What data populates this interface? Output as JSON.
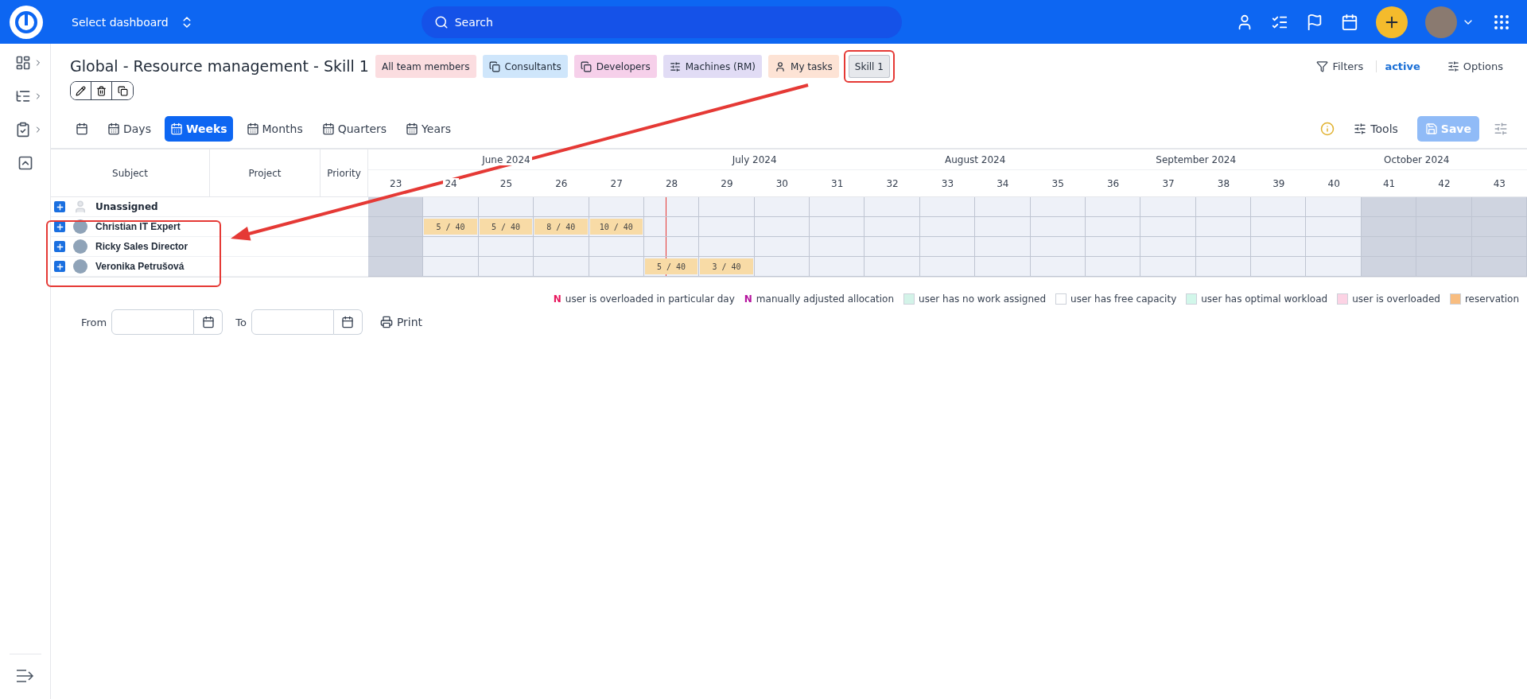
{
  "topbar": {
    "dashboard_select": "Select dashboard",
    "search": {
      "placeholder": "Search"
    }
  },
  "header": {
    "title": "Global - Resource management - Skill 1",
    "chips": [
      {
        "label": "All team members",
        "color": "#fbdde0",
        "kind": "plain",
        "selected": false
      },
      {
        "label": "Consultants",
        "color": "#cfe6fb",
        "kind": "team",
        "selected": false
      },
      {
        "label": "Developers",
        "color": "#f6d0ea",
        "kind": "team",
        "selected": false
      },
      {
        "label": "Machines (RM)",
        "color": "#e1dcf5",
        "kind": "machine",
        "selected": false
      },
      {
        "label": "My tasks",
        "color": "#fde3d5",
        "kind": "personal",
        "selected": false
      },
      {
        "label": "Skill 1",
        "color": "#e6e8ec",
        "kind": "plain",
        "selected": true
      }
    ],
    "filters": {
      "label": "Filters",
      "state": "active"
    },
    "options": "Options"
  },
  "views": [
    {
      "kind": "icon",
      "selected": false
    },
    {
      "kind": "text",
      "label": "Days",
      "selected": false
    },
    {
      "kind": "text",
      "label": "Weeks",
      "selected": true
    },
    {
      "kind": "text",
      "label": "Months",
      "selected": false
    },
    {
      "kind": "text",
      "label": "Quarters",
      "selected": false
    },
    {
      "kind": "text",
      "label": "Years",
      "selected": false
    }
  ],
  "toolbar": {
    "tools": "Tools",
    "save": {
      "label": "Save",
      "disabled": true
    }
  },
  "table": {
    "columns": [
      "Subject",
      "Project",
      "Priority"
    ],
    "months": [
      {
        "label": "June 2024",
        "weeks": [
          {
            "label": "23",
            "shaded": true
          },
          {
            "label": "24",
            "shaded": false
          },
          {
            "label": "25",
            "shaded": false
          },
          {
            "label": "26",
            "shaded": false
          },
          {
            "label": "27",
            "shaded": false
          }
        ]
      },
      {
        "label": "July 2024",
        "weeks": [
          {
            "label": "28",
            "shaded": false,
            "today": true
          },
          {
            "label": "29",
            "shaded": false
          },
          {
            "label": "30",
            "shaded": false
          },
          {
            "label": "31",
            "shaded": false
          }
        ]
      },
      {
        "label": "August 2024",
        "weeks": [
          {
            "label": "32",
            "shaded": false
          },
          {
            "label": "33",
            "shaded": false
          },
          {
            "label": "34",
            "shaded": false
          },
          {
            "label": "35",
            "shaded": false
          }
        ]
      },
      {
        "label": "September 2024",
        "weeks": [
          {
            "label": "36",
            "shaded": false
          },
          {
            "label": "37",
            "shaded": false
          },
          {
            "label": "38",
            "shaded": false
          },
          {
            "label": "39",
            "shaded": false
          }
        ]
      },
      {
        "label": "October 2024",
        "weeks": [
          {
            "label": "40",
            "shaded": false
          },
          {
            "label": "41",
            "shaded": true
          },
          {
            "label": "42",
            "shaded": true
          },
          {
            "label": "43",
            "shaded": true
          }
        ]
      }
    ],
    "rows": [
      {
        "name": "Unassigned",
        "kind": "unassigned",
        "cells": [
          {
            "kind": "empty"
          },
          {
            "kind": "empty"
          },
          {
            "kind": "empty"
          },
          {
            "kind": "empty"
          },
          {
            "kind": "empty"
          },
          {
            "kind": "empty"
          },
          {
            "kind": "empty"
          },
          {
            "kind": "empty"
          },
          {
            "kind": "empty"
          },
          {
            "kind": "empty"
          },
          {
            "kind": "empty"
          },
          {
            "kind": "empty"
          },
          {
            "kind": "empty"
          },
          {
            "kind": "empty"
          },
          {
            "kind": "empty"
          },
          {
            "kind": "empty"
          },
          {
            "kind": "empty"
          },
          {
            "kind": "empty"
          },
          {
            "kind": "empty"
          },
          {
            "kind": "empty"
          },
          {
            "kind": "empty"
          }
        ]
      },
      {
        "name": "Christian IT Expert",
        "kind": "user",
        "cells": [
          {
            "kind": "empty"
          },
          {
            "kind": "reservation",
            "text": "5 / 40"
          },
          {
            "kind": "reservation",
            "text": "5 / 40"
          },
          {
            "kind": "reservation",
            "text": "8 / 40"
          },
          {
            "kind": "reservation",
            "text": "10 / 40"
          },
          {
            "kind": "empty"
          },
          {
            "kind": "empty"
          },
          {
            "kind": "empty"
          },
          {
            "kind": "empty"
          },
          {
            "kind": "empty"
          },
          {
            "kind": "empty"
          },
          {
            "kind": "empty"
          },
          {
            "kind": "empty"
          },
          {
            "kind": "empty"
          },
          {
            "kind": "empty"
          },
          {
            "kind": "empty"
          },
          {
            "kind": "empty"
          },
          {
            "kind": "empty"
          },
          {
            "kind": "empty"
          },
          {
            "kind": "empty"
          },
          {
            "kind": "empty"
          }
        ]
      },
      {
        "name": "Ricky Sales Director",
        "kind": "user",
        "cells": [
          {
            "kind": "empty"
          },
          {
            "kind": "empty"
          },
          {
            "kind": "empty"
          },
          {
            "kind": "empty"
          },
          {
            "kind": "empty"
          },
          {
            "kind": "empty"
          },
          {
            "kind": "empty"
          },
          {
            "kind": "empty"
          },
          {
            "kind": "empty"
          },
          {
            "kind": "empty"
          },
          {
            "kind": "empty"
          },
          {
            "kind": "empty"
          },
          {
            "kind": "empty"
          },
          {
            "kind": "empty"
          },
          {
            "kind": "empty"
          },
          {
            "kind": "empty"
          },
          {
            "kind": "empty"
          },
          {
            "kind": "empty"
          },
          {
            "kind": "empty"
          },
          {
            "kind": "empty"
          },
          {
            "kind": "empty"
          }
        ]
      },
      {
        "name": "Veronika Petrušová",
        "kind": "user",
        "cells": [
          {
            "kind": "empty"
          },
          {
            "kind": "empty"
          },
          {
            "kind": "empty"
          },
          {
            "kind": "empty"
          },
          {
            "kind": "empty"
          },
          {
            "kind": "reservation",
            "text": "5 / 40"
          },
          {
            "kind": "reservation",
            "text": "3 / 40"
          },
          {
            "kind": "empty"
          },
          {
            "kind": "empty"
          },
          {
            "kind": "empty"
          },
          {
            "kind": "empty"
          },
          {
            "kind": "empty"
          },
          {
            "kind": "empty"
          },
          {
            "kind": "empty"
          },
          {
            "kind": "empty"
          },
          {
            "kind": "empty"
          },
          {
            "kind": "empty"
          },
          {
            "kind": "empty"
          },
          {
            "kind": "empty"
          },
          {
            "kind": "empty"
          },
          {
            "kind": "empty"
          }
        ]
      }
    ]
  },
  "legend": [
    {
      "kind": "letter",
      "letter": "N",
      "color": "#e8175d",
      "label": "user is overloaded in particular day"
    },
    {
      "kind": "letter",
      "letter": "N",
      "color": "#b5139e",
      "label": "manually adjusted allocation"
    },
    {
      "kind": "swatch",
      "color": "#d3f3e8",
      "label": "user has no work assigned"
    },
    {
      "kind": "swatch",
      "color": "#ffffff",
      "label": "user has free capacity"
    },
    {
      "kind": "swatch",
      "color": "#d2f7ea",
      "label": "user has optimal workload"
    },
    {
      "kind": "swatch",
      "color": "#fcd3e4",
      "label": "user is overloaded"
    },
    {
      "kind": "swatch",
      "color": "#f8bd80",
      "label": "reservation"
    }
  ],
  "print_bar": {
    "from": "From",
    "to": "To",
    "print": "Print"
  }
}
